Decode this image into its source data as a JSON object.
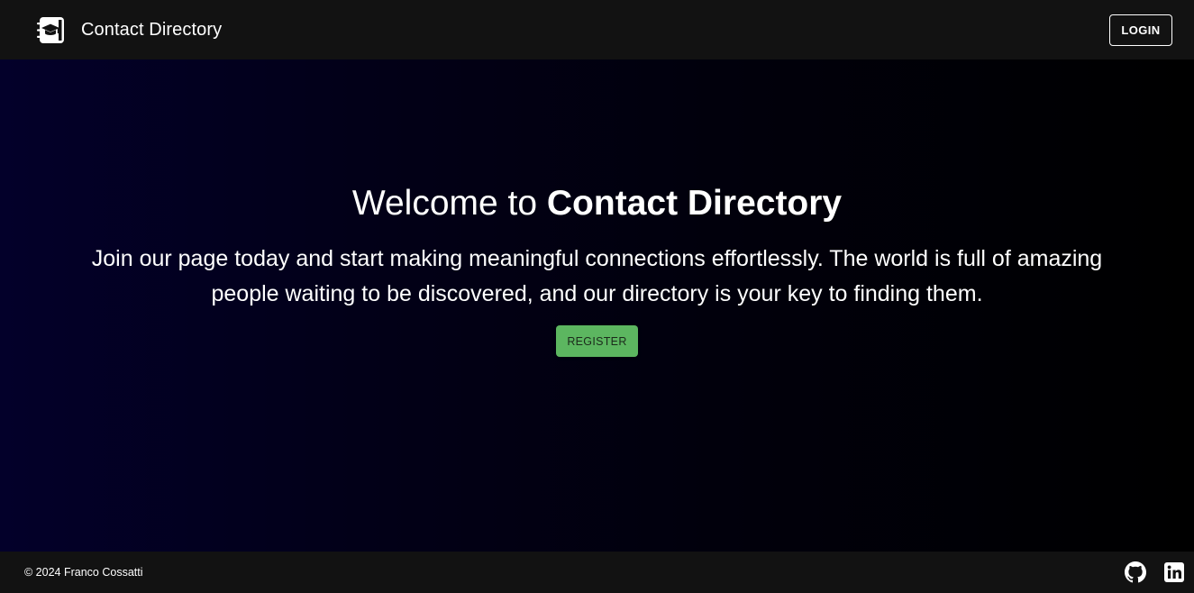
{
  "header": {
    "logo_icon": "school-book-icon",
    "title": "Contact Directory",
    "login_label": "LOGIN"
  },
  "hero": {
    "title_prefix": "Welcome to ",
    "title_emphasis": "Contact Directory",
    "text": "Join our page today and start making meaningful connections effortlessly. The world is full of amazing people waiting to be discovered, and our directory is your key to finding them.",
    "register_label": "REGISTER"
  },
  "footer": {
    "copyright": "© 2024 Franco Cossatti",
    "social": [
      {
        "icon": "github-icon"
      },
      {
        "icon": "linkedin-icon"
      }
    ]
  },
  "colors": {
    "navbar_bg": "#121212",
    "hero_gradient_start": "#03002a",
    "hero_gradient_end": "#000000",
    "register_bg": "#5cb660",
    "text": "#ffffff"
  }
}
